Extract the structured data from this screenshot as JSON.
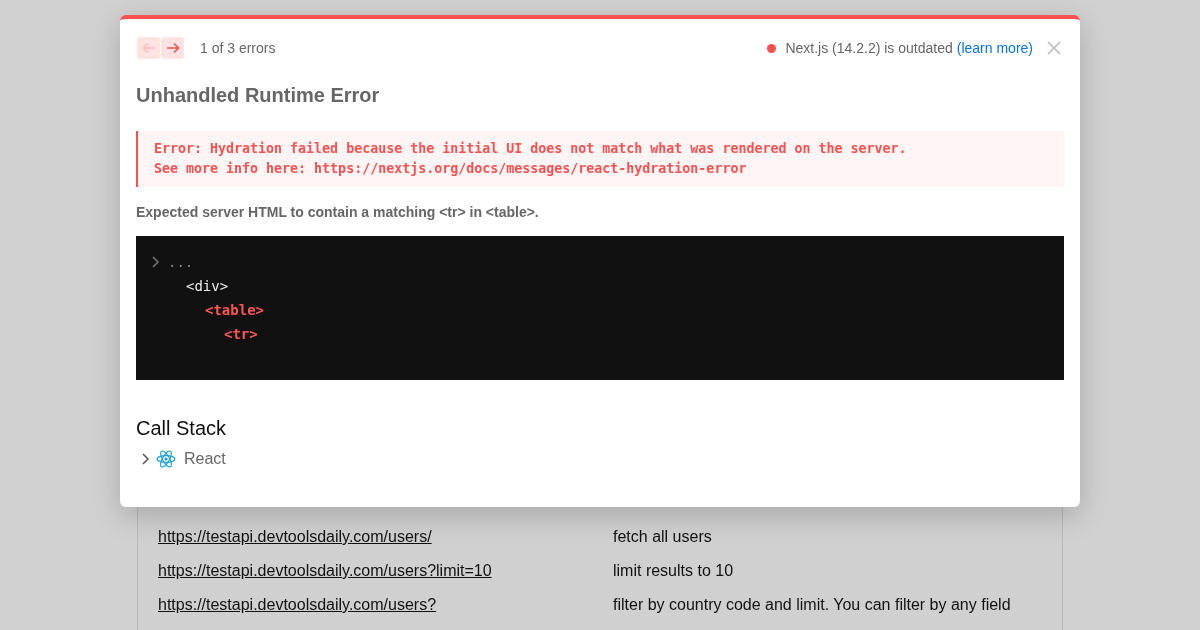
{
  "background_page": {
    "rows": [
      {
        "url": "https://testapi.devtoolsdaily.com/users/",
        "description": "fetch all users"
      },
      {
        "url": "https://testapi.devtoolsdaily.com/users?limit=10",
        "description": "limit results to 10"
      },
      {
        "url": "https://testapi.devtoolsdaily.com/users?",
        "description": "filter by country code and limit. You can filter by any field"
      }
    ]
  },
  "dialog": {
    "nav": [
      {
        "kind": "prev",
        "disabled": true
      },
      {
        "kind": "next",
        "disabled": false
      }
    ],
    "error_count": "1 of 3 errors",
    "version_notice": {
      "text": "Next.js (14.2.2) is outdated",
      "link": "(learn more)",
      "color": "#fa5050"
    },
    "title": "Unhandled Runtime Error",
    "error_message": [
      "Error: Hydration failed because the initial UI does not match what was rendered on the server.",
      "See more info here: https://nextjs.org/docs/messages/react-hydration-error"
    ],
    "description": "Expected server HTML to contain a matching <tr> in <table>.",
    "code_tree": [
      {
        "kind": "collapsed",
        "text": "...",
        "children": [
          {
            "kind": "tag",
            "text": "<div>",
            "children": [
              {
                "kind": "mismatch",
                "text": "<table>",
                "children": [
                  {
                    "kind": "mismatch",
                    "text": "<tr>"
                  }
                ]
              }
            ]
          }
        ]
      }
    ],
    "call_stack": {
      "heading": "Call Stack",
      "frames": [
        {
          "label": "React",
          "expanded": false
        }
      ]
    }
  }
}
